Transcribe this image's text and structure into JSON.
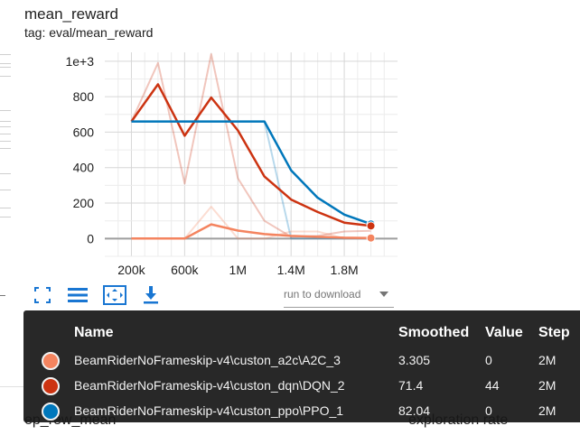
{
  "header": {
    "title": "mean_reward",
    "subtitle": "tag: eval/mean_reward"
  },
  "toolbar": {
    "fit_icon": "fit-domain-icon",
    "data_icon": "data-table-icon",
    "expand_icon": "expand-icon",
    "download_icon": "download-icon",
    "download_label": "run to download"
  },
  "chart_data": {
    "type": "line",
    "title": "mean_reward",
    "xlabel": "",
    "ylabel": "",
    "xlim": [
      0,
      2200000
    ],
    "ylim": [
      -100,
      1050
    ],
    "grid": true,
    "x_ticks": [
      200000,
      600000,
      1000000,
      1400000,
      1800000
    ],
    "x_tick_labels": [
      "200k",
      "600k",
      "1M",
      "1.4M",
      "1.8M"
    ],
    "y_ticks": [
      0,
      200,
      400,
      600,
      800,
      1000
    ],
    "y_tick_labels": [
      "0",
      "200",
      "400",
      "600",
      "800",
      "1e+3"
    ],
    "series": [
      {
        "name": "BeamRiderNoFrameskip-v4\\custon_a2c\\A2C_3",
        "color": "#f4845f",
        "raw_x": [
          200000,
          400000,
          600000,
          800000,
          1000000,
          1200000,
          1400000,
          1600000,
          1800000,
          2000000
        ],
        "raw_y": [
          0,
          0,
          0,
          180,
          0,
          0,
          40,
          40,
          0,
          0
        ],
        "smoothed_x": [
          200000,
          400000,
          600000,
          800000,
          1000000,
          1200000,
          1400000,
          1600000,
          1800000,
          2000000
        ],
        "smoothed_y": [
          0,
          0,
          0,
          80,
          45,
          25,
          15,
          10,
          5,
          3.305
        ]
      },
      {
        "name": "BeamRiderNoFrameskip-v4\\custon_dqn\\DQN_2",
        "color": "#cc3311",
        "raw_x": [
          200000,
          400000,
          600000,
          800000,
          1000000,
          1200000,
          1400000,
          1600000,
          1800000,
          2000000
        ],
        "raw_y": [
          660,
          990,
          310,
          1040,
          340,
          100,
          10,
          15,
          40,
          44
        ],
        "smoothed_x": [
          200000,
          400000,
          600000,
          800000,
          1000000,
          1200000,
          1400000,
          1600000,
          1800000,
          2000000
        ],
        "smoothed_y": [
          660,
          870,
          580,
          795,
          610,
          350,
          220,
          150,
          90,
          71.4
        ]
      },
      {
        "name": "BeamRiderNoFrameskip-v4\\custon_ppo\\PPO_1",
        "color": "#0077bb",
        "raw_x": [
          200000,
          1200000,
          1400000,
          1600000,
          1800000,
          2000000
        ],
        "raw_y": [
          660,
          660,
          0,
          0,
          0,
          0
        ],
        "smoothed_x": [
          200000,
          400000,
          600000,
          800000,
          1000000,
          1200000,
          1400000,
          1600000,
          1800000,
          2000000
        ],
        "smoothed_y": [
          660,
          660,
          660,
          660,
          660,
          660,
          385,
          230,
          135,
          82.04
        ]
      }
    ]
  },
  "tooltip": {
    "headers": {
      "name": "Name",
      "smoothed": "Smoothed",
      "value": "Value",
      "step": "Step"
    },
    "rows": [
      {
        "color": "#f4845f",
        "name": "BeamRiderNoFrameskip-v4\\custon_a2c\\A2C_3",
        "smoothed": "3.305",
        "value": "0",
        "step": "2M"
      },
      {
        "color": "#cc3311",
        "name": "BeamRiderNoFrameskip-v4\\custon_dqn\\DQN_2",
        "smoothed": "71.4",
        "value": "44",
        "step": "2M"
      },
      {
        "color": "#0077bb",
        "name": "BeamRiderNoFrameskip-v4\\custon_ppo\\PPO_1",
        "smoothed": "82.04",
        "value": "0",
        "step": "2M"
      }
    ]
  },
  "footer": {
    "left_title": "ep_rew_mean",
    "right_title": "exploration rate"
  }
}
